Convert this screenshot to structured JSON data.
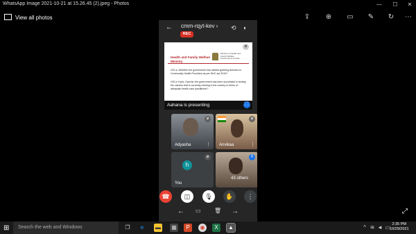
{
  "window": {
    "title": "WhatsApp Image 2021-10-21 at 15.26.45 (2).jpeg - Photos",
    "minimize": "—",
    "maximize": "☐",
    "close": "✕"
  },
  "toolbar": {
    "view_all": "View all photos",
    "icons": [
      "share-icon",
      "zoom-icon",
      "slideshow-icon",
      "edit-icon",
      "rotate-icon",
      "more-icon"
    ],
    "glyphs": {
      "share": "⇪",
      "zoom": "⊕",
      "slideshow": "▭",
      "edit": "✎",
      "rotate": "↻",
      "more": "⋯"
    }
  },
  "meeting": {
    "back": "←",
    "code": "cmm-rqyt-kev ›",
    "rec_label": "REC",
    "slide": {
      "brand": "Health and Family Welfare Ministry",
      "ministry": "Ministry of Health and Family Welfare Government of India",
      "q1": "•SO-a, Whether the government has started granting licenses to Community Health Providers as per NHC act 2019?",
      "q2": "•SO-b If yes, How far the government has been successful in testing the vaccine that is currently existing in the country in terms of adequate health care practitioner?"
    },
    "presenting": "Aahana is presenting",
    "participants": [
      {
        "name": "Adyasha"
      },
      {
        "name": "Anvikaa"
      },
      {
        "name": "You",
        "initial": "h"
      },
      {
        "name": "43 others"
      }
    ],
    "more_glyph": "⋮",
    "controls": {
      "hangup": "☎",
      "camera": "◫",
      "mic": "🎙",
      "hand": "✋",
      "more": "⋮"
    },
    "nav": {
      "back": "←",
      "menu": "▭",
      "trash": "🗑",
      "forward": "→"
    },
    "colors": {
      "hangup": "#ea4335",
      "rec": "#d93025",
      "avatar_h": "#12939a",
      "fullscreen": "#1a73e8"
    }
  },
  "taskbar": {
    "search_placeholder": "Search the web and Windows",
    "time": "2:35 PM",
    "date": "10/29/2021"
  }
}
